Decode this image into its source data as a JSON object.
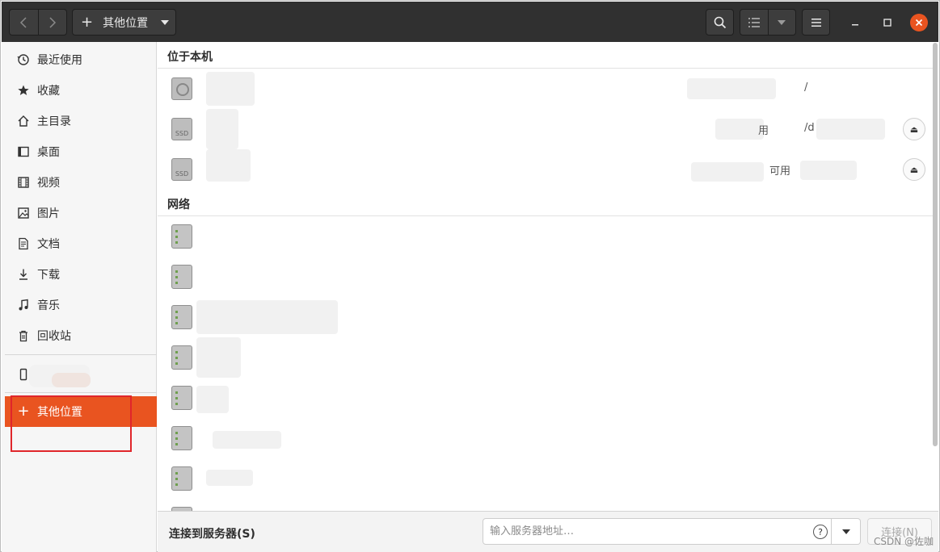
{
  "header": {
    "path_label": "其他位置"
  },
  "sidebar": {
    "items": [
      {
        "label": "最近使用",
        "icon": "clock-icon"
      },
      {
        "label": "收藏",
        "icon": "star-icon"
      },
      {
        "label": "主目录",
        "icon": "home-icon"
      },
      {
        "label": "桌面",
        "icon": "desktop-icon"
      },
      {
        "label": "视频",
        "icon": "video-icon"
      },
      {
        "label": "图片",
        "icon": "picture-icon"
      },
      {
        "label": "文档",
        "icon": "document-icon"
      },
      {
        "label": "下载",
        "icon": "download-icon"
      },
      {
        "label": "音乐",
        "icon": "music-icon"
      },
      {
        "label": "回收站",
        "icon": "trash-icon"
      }
    ],
    "other_locations_label": "其他位置"
  },
  "main": {
    "local_section": "位于本机",
    "local_rows": [
      {
        "mount": "/",
        "status": ""
      },
      {
        "mount": "/d",
        "status": "用"
      },
      {
        "mount": "",
        "status": "可用"
      }
    ],
    "network_section": "网络"
  },
  "bottom": {
    "label": "连接到服务器(S)",
    "placeholder": "输入服务器地址…",
    "connect_label": "连接(N)"
  },
  "watermark": "CSDN @佐咖",
  "colors": {
    "accent": "#e95420",
    "headerbar": "#303030",
    "highlight_box": "#e0262b"
  }
}
